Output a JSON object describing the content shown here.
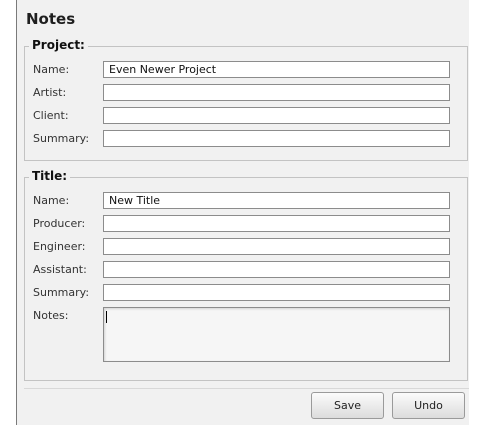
{
  "panel": {
    "title": "Notes"
  },
  "project": {
    "legend": "Project:",
    "fields": [
      {
        "label": "Name:",
        "value": "Even Newer Project"
      },
      {
        "label": "Artist:",
        "value": ""
      },
      {
        "label": "Client:",
        "value": ""
      },
      {
        "label": "Summary:",
        "value": ""
      }
    ]
  },
  "title_group": {
    "legend": "Title:",
    "fields": [
      {
        "label": "Name:",
        "value": "New Title"
      },
      {
        "label": "Producer:",
        "value": ""
      },
      {
        "label": "Engineer:",
        "value": ""
      },
      {
        "label": "Assistant:",
        "value": ""
      },
      {
        "label": "Summary:",
        "value": ""
      }
    ],
    "notes_label": "Notes:",
    "notes_value": ""
  },
  "buttons": {
    "save": "Save",
    "undo": "Undo"
  }
}
